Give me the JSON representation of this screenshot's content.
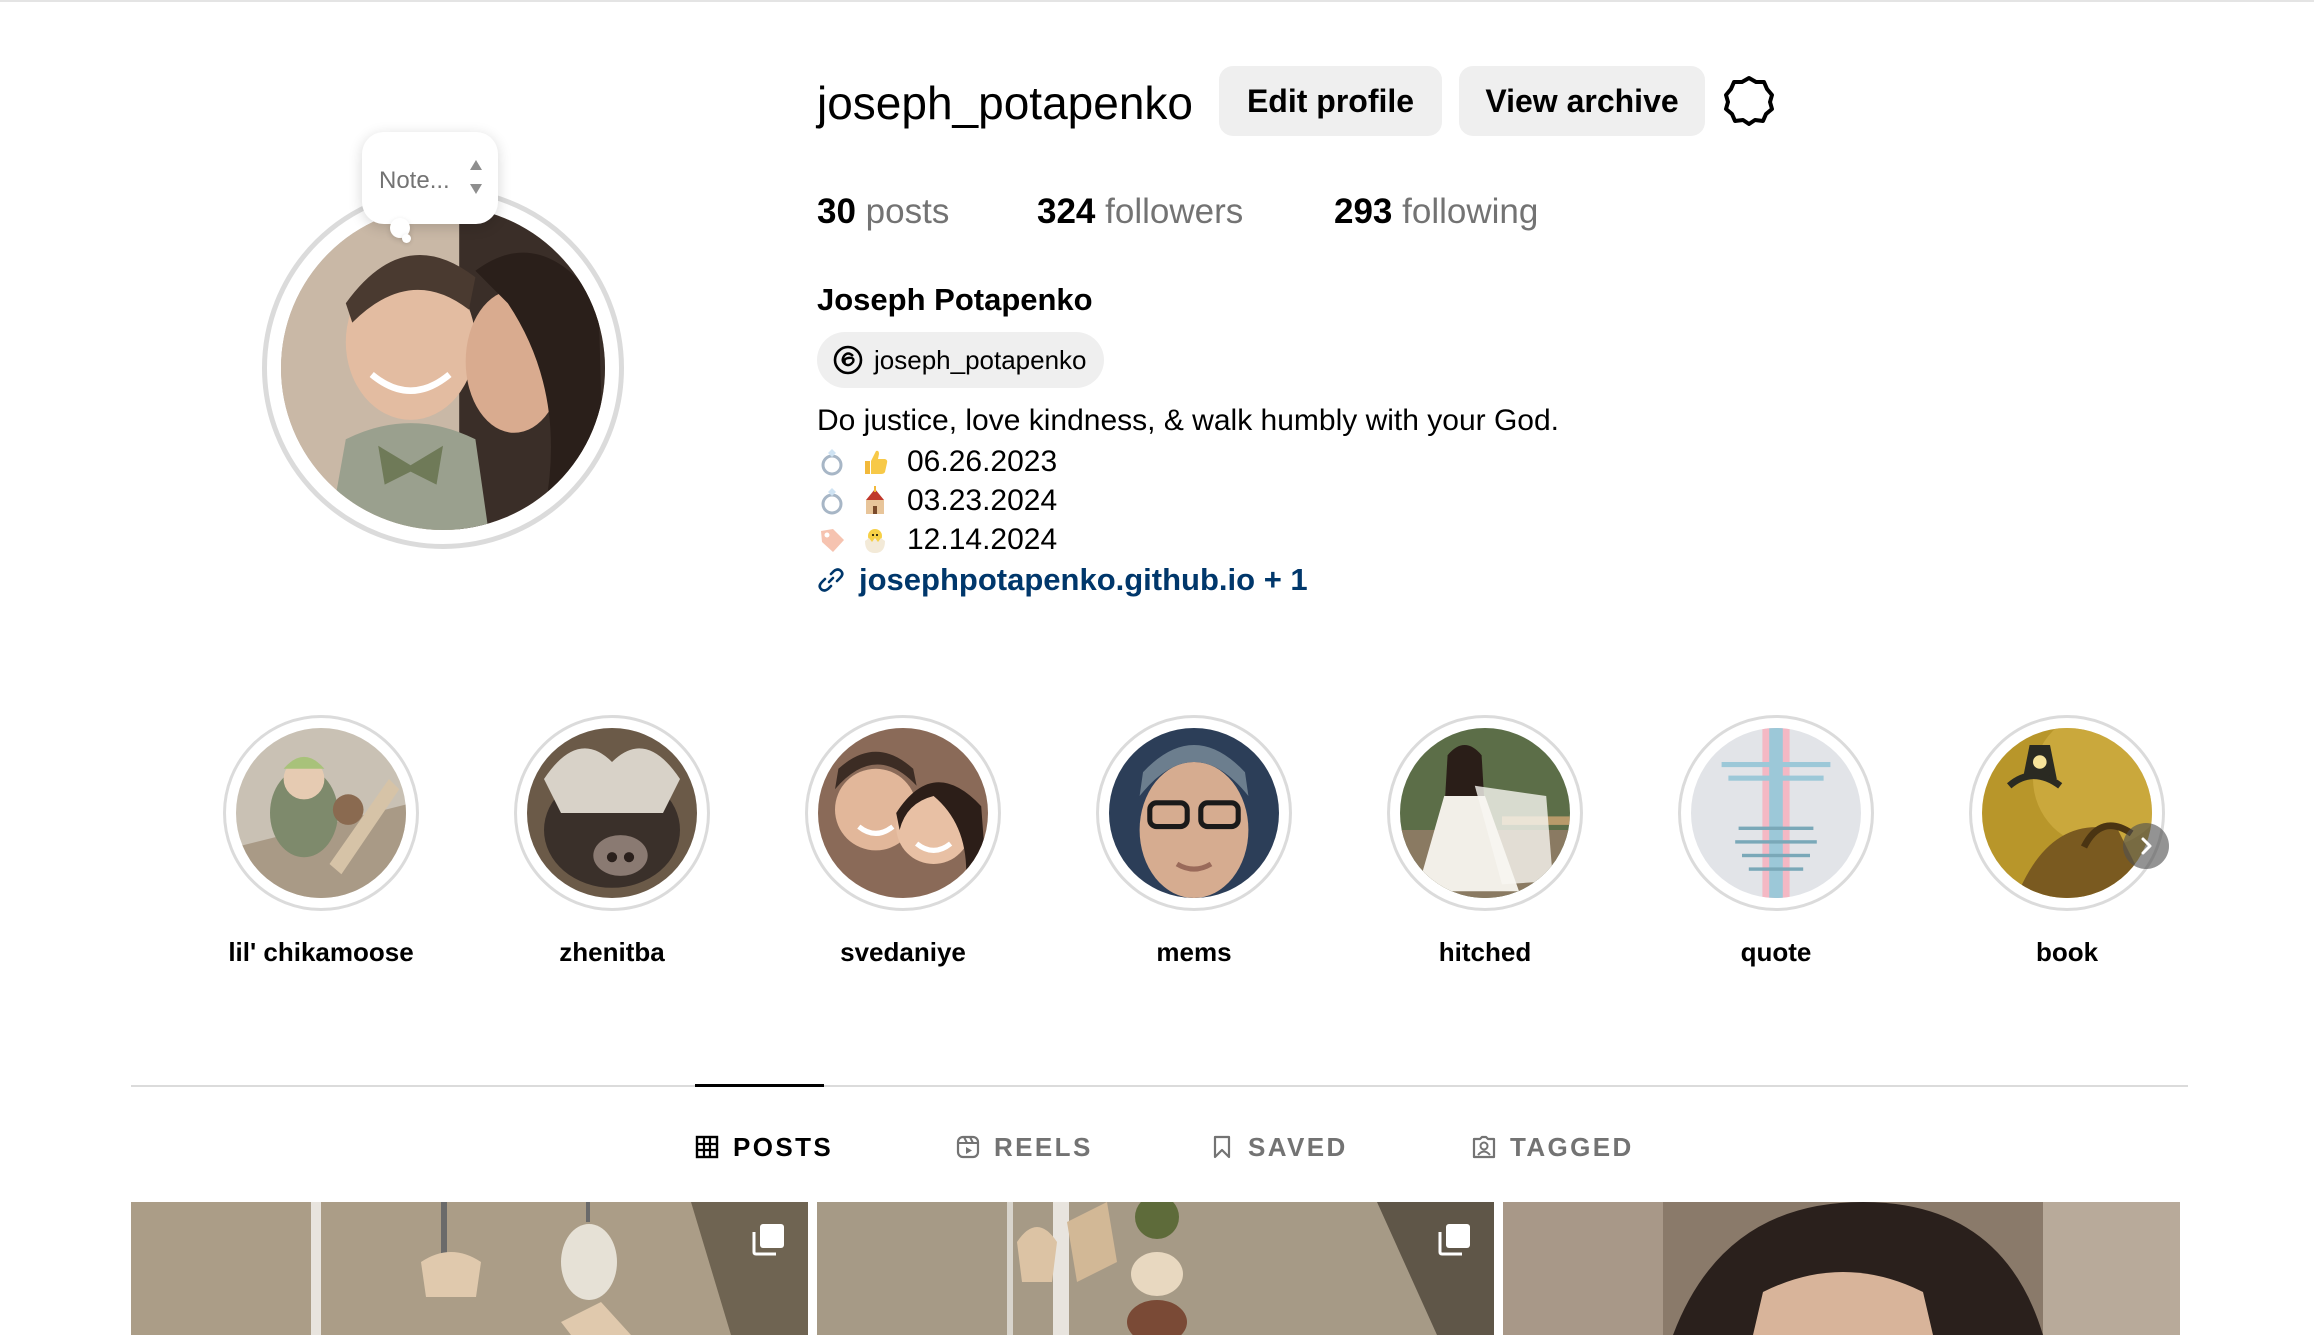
{
  "profile": {
    "username": "joseph_potapenko",
    "full_name": "Joseph Potapenko",
    "note_placeholder": "Note...",
    "edit_profile_label": "Edit profile",
    "view_archive_label": "View archive",
    "stats": {
      "posts_count": "30",
      "posts_label": "posts",
      "followers_count": "324",
      "followers_label": "followers",
      "following_count": "293",
      "following_label": "following"
    },
    "threads_handle": "joseph_potapenko",
    "bio": {
      "line1": "Do justice, love kindness, & walk humbly with your God.",
      "date1": "06.26.2023",
      "date2": "03.23.2024",
      "date3": "12.14.2024"
    },
    "link_text": "josephpotapenko.github.io + 1"
  },
  "highlights": [
    {
      "label": "lil' chikamoose"
    },
    {
      "label": "zhenitba"
    },
    {
      "label": "svedaniye"
    },
    {
      "label": "mems"
    },
    {
      "label": "hitched"
    },
    {
      "label": "quote"
    },
    {
      "label": "book"
    }
  ],
  "tabs": {
    "posts": "POSTS",
    "reels": "REELS",
    "saved": "SAVED",
    "tagged": "TAGGED"
  },
  "colors": {
    "link": "#00376b",
    "secondary_text": "#737373",
    "button_bg": "#efefef",
    "border": "#dbdbdb"
  },
  "icons": {
    "settings": "gear-icon",
    "threads": "threads-icon",
    "link": "link-icon",
    "posts_tab": "grid-icon",
    "reels_tab": "reels-icon",
    "saved_tab": "bookmark-icon",
    "tagged_tab": "tagged-icon",
    "carousel": "multiple-posts-icon",
    "next": "chevron-right-icon"
  }
}
